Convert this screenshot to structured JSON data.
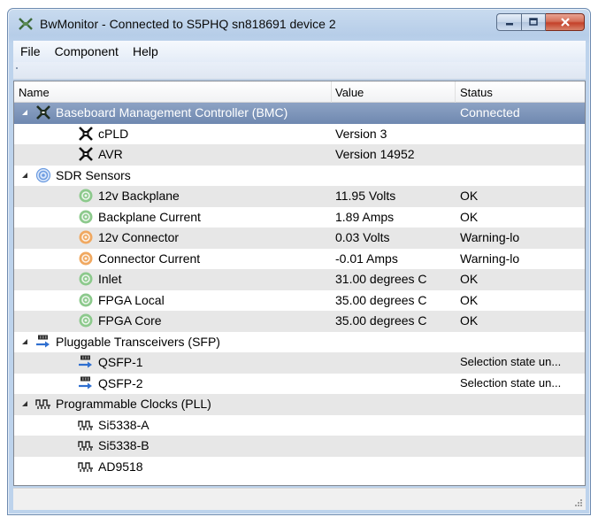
{
  "window": {
    "title": "BwMonitor - Connected to S5PHQ sn818691 device 2"
  },
  "menu": [
    "File",
    "Component",
    "Help"
  ],
  "columns": {
    "name": "Name",
    "value": "Value",
    "status": "Status"
  },
  "rows": [
    {
      "name": "Baseboard Management Controller (BMC)",
      "value": "",
      "status": "Connected",
      "icon": "bmc-chip-icon",
      "level": 0,
      "selected": true
    },
    {
      "name": "cPLD",
      "value": "Version 3",
      "status": "",
      "icon": "chip-icon",
      "level": 1
    },
    {
      "name": "AVR",
      "value": "Version 14952",
      "status": "",
      "icon": "chip-icon",
      "level": 1
    },
    {
      "name": "SDR Sensors",
      "value": "",
      "status": "",
      "icon": "sensor-group-icon",
      "level": 0
    },
    {
      "name": "12v Backplane",
      "value": "11.95 Volts",
      "status": "OK",
      "icon": "sensor-ok-icon",
      "level": 1
    },
    {
      "name": "Backplane Current",
      "value": "1.89 Amps",
      "status": "OK",
      "icon": "sensor-ok-icon",
      "level": 1
    },
    {
      "name": "12v Connector",
      "value": "0.03 Volts",
      "status": "Warning-lo",
      "icon": "sensor-warning-icon",
      "level": 1
    },
    {
      "name": "Connector Current",
      "value": "-0.01 Amps",
      "status": "Warning-lo",
      "icon": "sensor-warning-icon",
      "level": 1
    },
    {
      "name": "Inlet",
      "value": "31.00 degrees C",
      "status": "OK",
      "icon": "sensor-ok-icon",
      "level": 1
    },
    {
      "name": "FPGA Local",
      "value": "35.00 degrees C",
      "status": "OK",
      "icon": "sensor-ok-icon",
      "level": 1
    },
    {
      "name": "FPGA Core",
      "value": "35.00 degrees C",
      "status": "OK",
      "icon": "sensor-ok-icon",
      "level": 1
    },
    {
      "name": "Pluggable Transceivers (SFP)",
      "value": "",
      "status": "",
      "icon": "transceiver-icon",
      "level": 0
    },
    {
      "name": "QSFP-1",
      "value": "",
      "status": "Selection state un...",
      "icon": "transceiver-icon",
      "level": 1
    },
    {
      "name": "QSFP-2",
      "value": "",
      "status": "Selection state un...",
      "icon": "transceiver-icon",
      "level": 1
    },
    {
      "name": "Programmable Clocks (PLL)",
      "value": "",
      "status": "",
      "icon": "clock-icon",
      "level": 0
    },
    {
      "name": "Si5338-A",
      "value": "",
      "status": "",
      "icon": "clock-icon",
      "level": 1
    },
    {
      "name": "Si5338-B",
      "value": "",
      "status": "",
      "icon": "clock-icon",
      "level": 1
    },
    {
      "name": "AD9518",
      "value": "",
      "status": "",
      "icon": "clock-icon",
      "level": 1
    }
  ],
  "colors": {
    "selection": "#7890b6",
    "sensor_ok": "#8cc98c",
    "sensor_warning": "#f0a860",
    "sensor_group": "#6b9be0"
  }
}
